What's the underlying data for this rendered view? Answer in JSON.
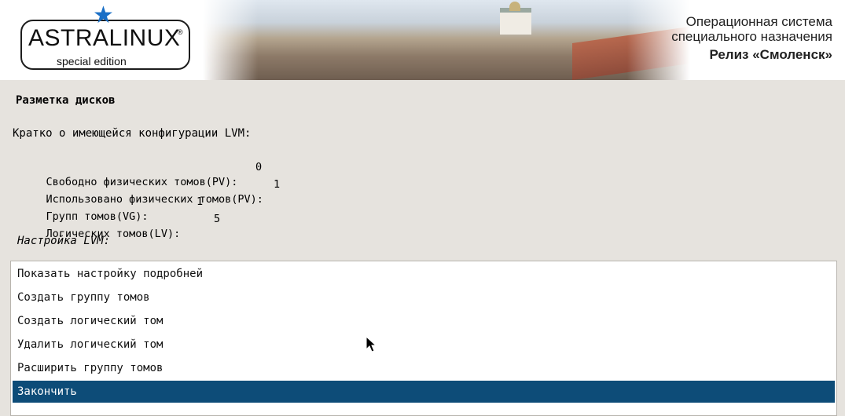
{
  "header": {
    "logo_text": "ASTRALINUX",
    "logo_registered": "®",
    "logo_subtitle": "special edition",
    "title_line1": "Операционная система",
    "title_line2": "специального назначения",
    "release": "Релиз «Смоленск»",
    "star_icon": "star-icon",
    "colors": {
      "star": "#1a6fc6",
      "wall": "#b7684e"
    }
  },
  "content": {
    "section_title": "Разметка дисков",
    "summary_heading": "Кратко о имеющейся конфигурации LVM:",
    "stats": [
      {
        "label": "Свободно физических томов(PV):",
        "value": "0"
      },
      {
        "label": "Использовано физических томов(PV):",
        "value": "1"
      },
      {
        "label": "Групп томов(VG):",
        "value": "1"
      },
      {
        "label": "Логических томов(LV):",
        "value": "5"
      }
    ],
    "lvm_label": "Настройка LVM:"
  },
  "menu": {
    "items": [
      {
        "label": "Показать настройку подробней"
      },
      {
        "label": "Создать группу томов"
      },
      {
        "label": "Создать логический том"
      },
      {
        "label": "Удалить логический том"
      },
      {
        "label": "Расширить группу томов"
      },
      {
        "label": "Закончить",
        "selected": true
      }
    ]
  },
  "colors": {
    "background": "#e6e3de",
    "selection": "#0d4c78"
  }
}
